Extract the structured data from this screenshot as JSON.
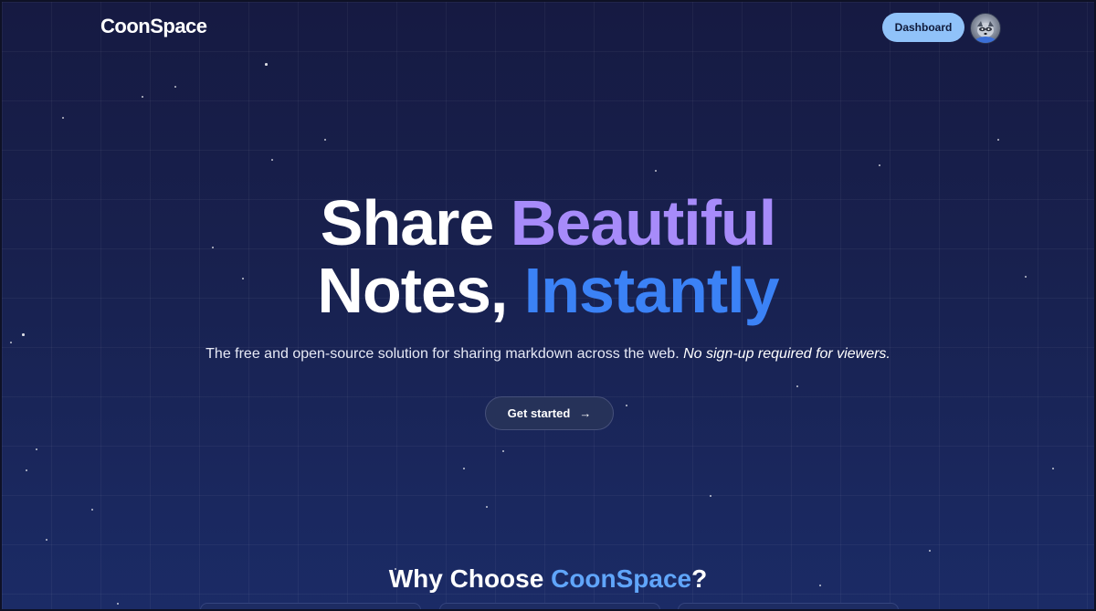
{
  "header": {
    "logo": "CoonSpace",
    "dashboard_label": "Dashboard"
  },
  "hero": {
    "headline_word1": "Share",
    "headline_word2": "Beautiful",
    "headline_word3": "Notes,",
    "headline_word4": "Instantly",
    "subtitle_text": "The free and open-source solution for sharing markdown across the web.",
    "subtitle_emphasis": "No sign-up required for viewers.",
    "cta_label": "Get started",
    "cta_icon": "arrow-right-icon"
  },
  "features": {
    "heading_prefix": "Why Choose",
    "heading_brand": "CoonSpace",
    "heading_suffix": "?"
  },
  "colors": {
    "accent_purple": "#a78bfa",
    "accent_blue": "#3b82f6",
    "dashboard_button": "#90c2f9",
    "background": "#18214f"
  }
}
